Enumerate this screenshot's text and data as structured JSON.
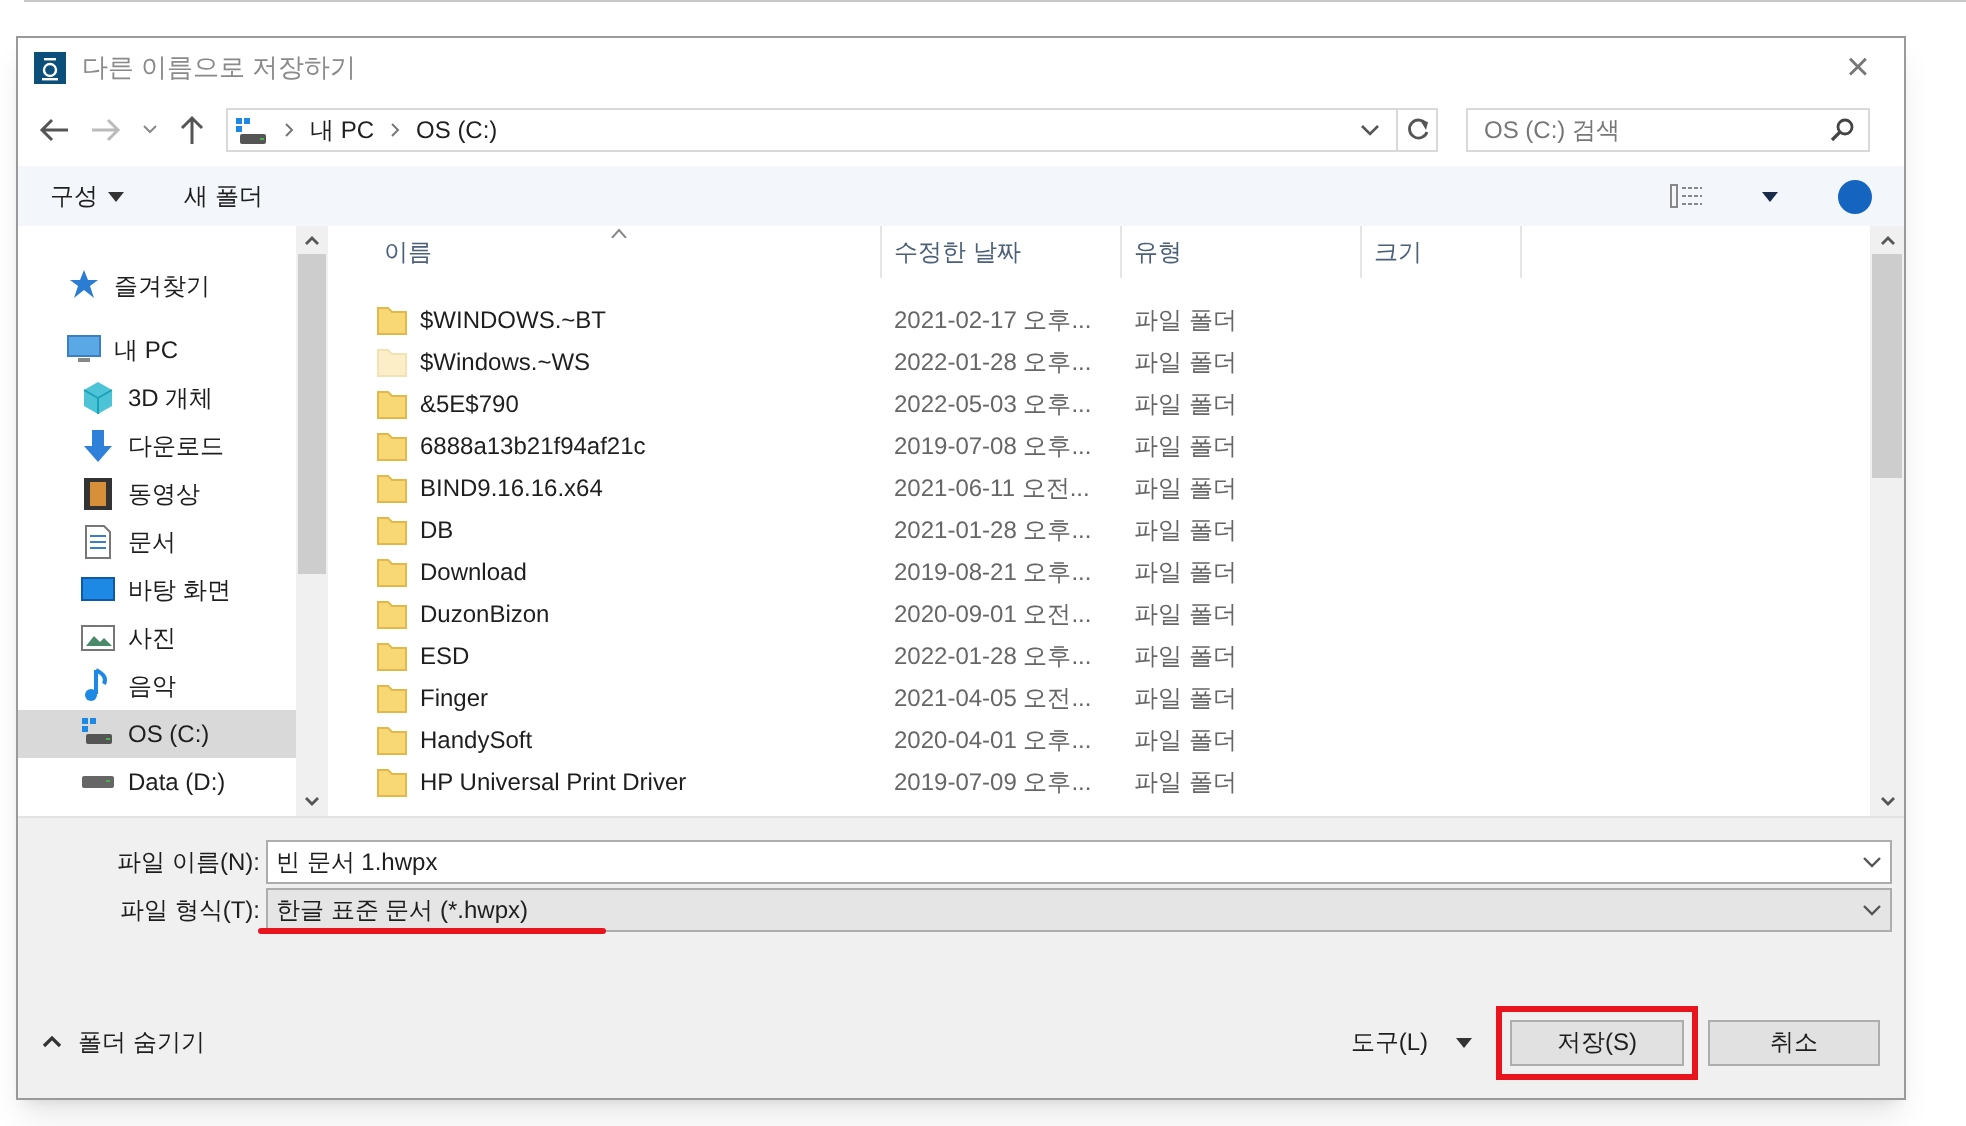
{
  "window": {
    "title": "다른 이름으로 저장하기",
    "close": "×"
  },
  "nav": {
    "path": [
      "내 PC",
      "OS (C:)"
    ],
    "search": {
      "placeholder": "OS (C:) 검색"
    }
  },
  "toolbar": {
    "organize": "구성",
    "new_folder": "새 폴더"
  },
  "sidebar": {
    "items": [
      {
        "label": "즐겨찾기",
        "selected": false
      },
      {
        "label": "내 PC",
        "selected": false,
        "children": [
          {
            "label": "3D 개체",
            "selected": false
          },
          {
            "label": "다운로드",
            "selected": false
          },
          {
            "label": "동영상",
            "selected": false
          },
          {
            "label": "문서",
            "selected": false
          },
          {
            "label": "바탕 화면",
            "selected": false
          },
          {
            "label": "사진",
            "selected": false
          },
          {
            "label": "음악",
            "selected": false
          },
          {
            "label": "OS (C:)",
            "selected": true
          },
          {
            "label": "Data (D:)",
            "selected": false
          }
        ]
      }
    ]
  },
  "table": {
    "columns": [
      "이름",
      "수정한 날짜",
      "유형",
      "크기"
    ],
    "rows": [
      {
        "name": "$WINDOWS.~BT",
        "date": "2021-02-17 오후...",
        "type": "파일 폴더",
        "hidden": false
      },
      {
        "name": "$Windows.~WS",
        "date": "2022-01-28 오후...",
        "type": "파일 폴더",
        "hidden": true
      },
      {
        "name": "&5E$790",
        "date": "2022-05-03 오후...",
        "type": "파일 폴더",
        "hidden": false
      },
      {
        "name": "6888a13b21f94af21c",
        "date": "2019-07-08 오후...",
        "type": "파일 폴더",
        "hidden": false
      },
      {
        "name": "BIND9.16.16.x64",
        "date": "2021-06-11 오전...",
        "type": "파일 폴더",
        "hidden": false
      },
      {
        "name": "DB",
        "date": "2021-01-28 오후...",
        "type": "파일 폴더",
        "hidden": false
      },
      {
        "name": "Download",
        "date": "2019-08-21 오후...",
        "type": "파일 폴더",
        "hidden": false
      },
      {
        "name": "DuzonBizon",
        "date": "2020-09-01 오전...",
        "type": "파일 폴더",
        "hidden": false
      },
      {
        "name": "ESD",
        "date": "2022-01-28 오후...",
        "type": "파일 폴더",
        "hidden": false
      },
      {
        "name": "Finger",
        "date": "2021-04-05 오전...",
        "type": "파일 폴더",
        "hidden": false
      },
      {
        "name": "HandySoft",
        "date": "2020-04-01 오후...",
        "type": "파일 폴더",
        "hidden": false
      },
      {
        "name": "HP Universal Print Driver",
        "date": "2019-07-09 오후...",
        "type": "파일 폴더",
        "hidden": false
      }
    ]
  },
  "file_name": {
    "label": "파일 이름(N):",
    "value": "빈 문서 1.hwpx"
  },
  "file_type": {
    "label": "파일 형식(T):",
    "value": "한글 표준 문서 (*.hwpx)",
    "underlined": true
  },
  "footer": {
    "hide_folders": "폴더 숨기기",
    "tools": "도구(L)",
    "save": {
      "label": "저장(S)",
      "highlighted": true
    },
    "cancel": "취소"
  }
}
